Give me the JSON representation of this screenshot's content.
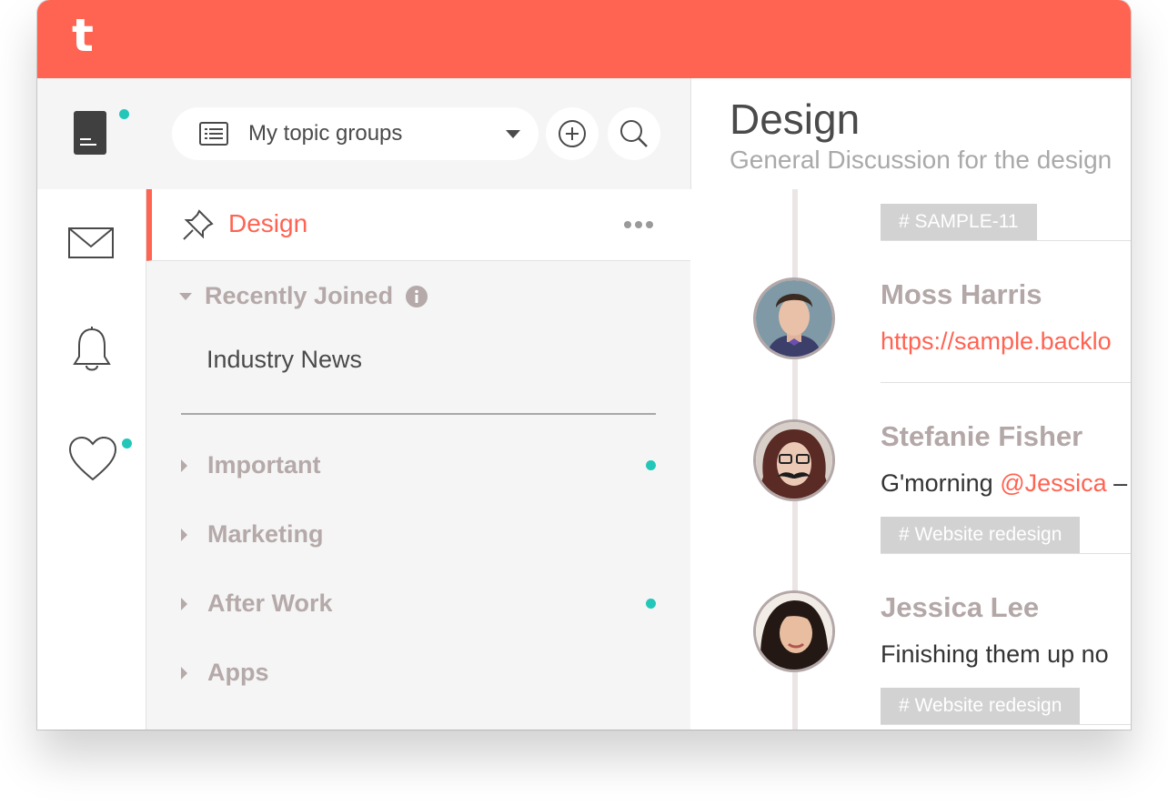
{
  "app": {
    "logo_letter": "t",
    "accent_color": "#ff6352",
    "status_dot_color": "#23c7b9"
  },
  "toolbar": {
    "group_selector": {
      "label": "My topic groups",
      "icon": "list-icon"
    },
    "add_icon": "plus-circle-icon",
    "search_icon": "search-icon"
  },
  "topic_header": {
    "title": "Design",
    "subtitle": "General Discussion for the design"
  },
  "rail": [
    {
      "icon": "mail-icon"
    },
    {
      "icon": "bell-icon"
    },
    {
      "icon": "heart-icon",
      "unread": true
    }
  ],
  "groups": {
    "active_topic": "Design",
    "recently_joined": {
      "label": "Recently Joined",
      "items": [
        "Industry News"
      ]
    },
    "items": [
      {
        "label": "Important",
        "unread": true
      },
      {
        "label": "Marketing",
        "unread": false
      },
      {
        "label": "After Work",
        "unread": true
      },
      {
        "label": "Apps",
        "unread": false
      }
    ]
  },
  "feed": {
    "top_tag": "# SAMPLE-11",
    "posts": [
      {
        "author": "Moss Harris",
        "message_link": "https://sample.backlo",
        "tag": ""
      },
      {
        "author": "Stefanie Fisher",
        "message_before": "G'morning ",
        "mention": "@Jessica",
        "message_after": " –",
        "tag": "# Website redesign"
      },
      {
        "author": "Jessica Lee",
        "message": "Finishing them up no",
        "tag": "# Website redesign"
      }
    ]
  }
}
